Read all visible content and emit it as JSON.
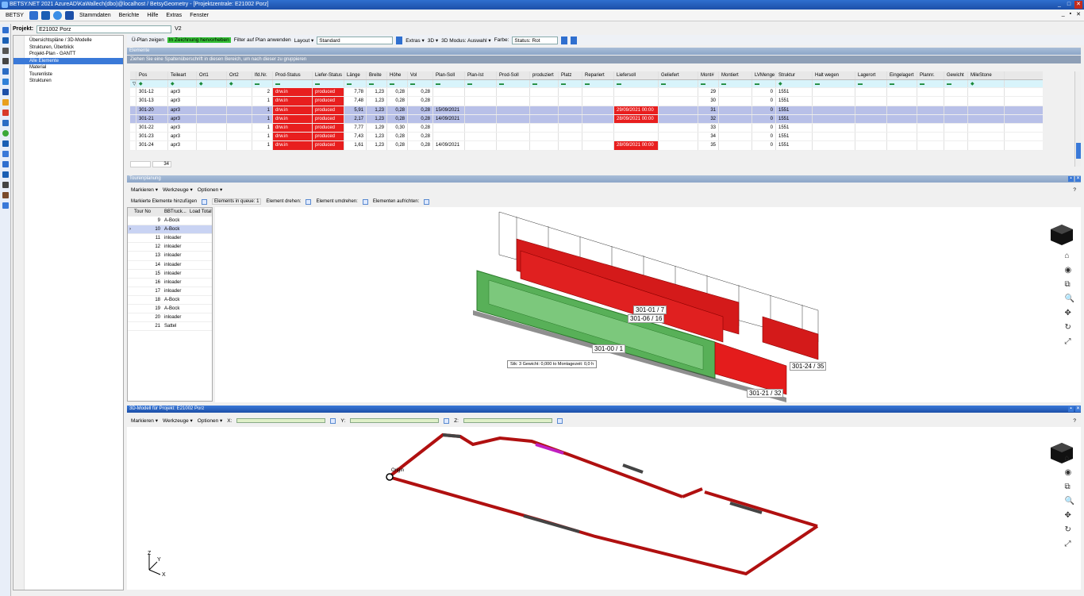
{
  "window": {
    "title": "BETSY.NET 2021  AzureAD\\KaWallech(dbo)@localhost / BetsyGeometry - [Projektzentrale: E21002 Porz]",
    "min": "_",
    "max": "□",
    "close": "✕"
  },
  "menu": {
    "app": "BETSY",
    "items": [
      "Stammdaten",
      "Berichte",
      "Hilfe",
      "Extras",
      "Fenster"
    ],
    "mdi": [
      "_",
      "▪",
      "✕"
    ]
  },
  "project": {
    "label": "Projekt:",
    "value": "E21002 Porz",
    "version": "V2"
  },
  "nav": {
    "items": [
      "Übersichtspläne / 3D-Modelle",
      "Strukturen, Überblick",
      "Projekt-Plan - GANTT",
      "Alle Elemente",
      "Material",
      "Tourenliste",
      "Strukturen"
    ],
    "selected": 3
  },
  "toolbar": {
    "plan_show": "Ü-Plan zeigen",
    "highlight": "In Zeichnung hervorheben",
    "filter": "Filter auf Plan anwenden",
    "layout": "Layout ▾",
    "layout_value": "Standard",
    "extras": "Extras ▾",
    "threeD": "3D ▾",
    "mode": "3D Modus: Auswahl ▾",
    "color_label": "Farbe:",
    "color_value": "Status: Rot"
  },
  "elements": {
    "header": "Elemente",
    "group_hint": "Ziehen Sie eine Spaltenüberschrift in diesen Bereich, um nach dieser zu gruppieren",
    "columns": [
      "Pos",
      "Teileart",
      "Ort1",
      "Ort2",
      "lfd.Nr.",
      "Prod-Status",
      "Liefer-Status",
      "Länge",
      "Breite",
      "Höhe",
      "Vol",
      "Plan-Soll",
      "Plan-Ist",
      "Prod-Soll",
      "produziert",
      "Platz",
      "Repariert",
      "Liefersoll",
      "Geliefert",
      "Mont#",
      "Montiert",
      "LVMenge",
      "Struktur",
      "Halt wegen",
      "Lagerort",
      "Eingelagert",
      "Plannr.",
      "Gewicht",
      "MileStone"
    ],
    "rows": [
      {
        "pos": "301-12",
        "teil": "apr3",
        "nr": "2",
        "prod": "drw.in",
        "lief": "produced",
        "l": "7,78",
        "b": "1,23",
        "h": "0,28",
        "plan": "",
        "liefer": "",
        "mont": "29",
        "lv": "0",
        "str": "1551",
        "sel": false
      },
      {
        "pos": "301-13",
        "teil": "apr3",
        "nr": "1",
        "prod": "drw.in",
        "lief": "produced",
        "l": "7,48",
        "b": "1,23",
        "h": "0,28",
        "plan": "",
        "liefer": "",
        "mont": "30",
        "lv": "0",
        "str": "1551",
        "sel": false
      },
      {
        "pos": "301-20",
        "teil": "apr3",
        "nr": "1",
        "prod": "drw.in",
        "lief": "produced",
        "l": "5,91",
        "b": "1,23",
        "h": "0,28",
        "plan": "15/09/2021",
        "liefer": "29/09/2021 00:00",
        "mont": "31",
        "lv": "0",
        "str": "1551",
        "sel": true
      },
      {
        "pos": "301-21",
        "teil": "apr3",
        "nr": "1",
        "prod": "drw.in",
        "lief": "produced",
        "l": "2,17",
        "b": "1,23",
        "h": "0,28",
        "plan": "14/09/2021",
        "liefer": "28/09/2021 00:00",
        "mont": "32",
        "lv": "0",
        "str": "1551",
        "sel": true
      },
      {
        "pos": "301-22",
        "teil": "apr3",
        "nr": "1",
        "prod": "drw.in",
        "lief": "produced",
        "l": "7,77",
        "b": "1,29",
        "h": "0,30",
        "plan": "",
        "liefer": "",
        "mont": "33",
        "lv": "0",
        "str": "1551",
        "sel": false
      },
      {
        "pos": "301-23",
        "teil": "apr3",
        "nr": "1",
        "prod": "drw.in",
        "lief": "produced",
        "l": "7,43",
        "b": "1,23",
        "h": "0,28",
        "plan": "",
        "liefer": "",
        "mont": "34",
        "lv": "0",
        "str": "1551",
        "sel": false
      },
      {
        "pos": "301-24",
        "teil": "apr3",
        "nr": "1",
        "prod": "drw.in",
        "lief": "produced",
        "l": "1,61",
        "b": "1,23",
        "h": "0,28",
        "plan": "14/09/2021",
        "liefer": "28/09/2021 00:00",
        "mont": "35",
        "lv": "0",
        "str": "1551",
        "sel": false
      }
    ],
    "count": "34"
  },
  "tour": {
    "header": "Tourenplanung",
    "menu": [
      "Markieren ▾",
      "Werkzeuge ▾",
      "Optionen ▾"
    ],
    "help": "?",
    "opts": {
      "add": "Markierte Elemente hinzufügen",
      "queue": "Elements in queue: 1",
      "rotate": "Element drehen:",
      "flip": "Element umdrehen:",
      "upright": "Elementen aufrichten:"
    },
    "columns": [
      "Tour No",
      "BBTruck...",
      "Load Total"
    ],
    "rows": [
      [
        "9",
        "A-Bock"
      ],
      [
        "10",
        "A-Bock"
      ],
      [
        "11",
        "inloader"
      ],
      [
        "12",
        "inloader"
      ],
      [
        "13",
        "inloader"
      ],
      [
        "14",
        "inloader"
      ],
      [
        "15",
        "inloader"
      ],
      [
        "16",
        "inloader"
      ],
      [
        "17",
        "inloader"
      ],
      [
        "18",
        "A-Bock"
      ],
      [
        "19",
        "A-Bock"
      ],
      [
        "20",
        "inloader"
      ],
      [
        "21",
        "Sattel"
      ]
    ],
    "selected": 1,
    "labels": [
      "301-01 / 7",
      "301-06 / 16",
      "301-00 / 1",
      "301-24 / 35",
      "301-21 / 32"
    ],
    "tooltip": "Stk: 3    Gewicht: 0,000 to    Montagezeit: 0,0 h"
  },
  "model": {
    "header": "3D-Modell für Projekt: E21002 Porz",
    "menu": [
      "Markieren ▾",
      "Werkzeuge ▾",
      "Optionen ▾"
    ],
    "x": "X:",
    "y": "Y:",
    "z": "Z:",
    "origin": "Origin",
    "help": "?",
    "axes": {
      "z": "Z",
      "y": "Y",
      "x": "X"
    }
  },
  "nav3d": {
    "icons": [
      "home-icon",
      "camera-icon",
      "zoom-box-icon",
      "zoom-icon",
      "pan-icon",
      "rotate-icon",
      "fit-icon"
    ],
    "glyphs": [
      "⌂",
      "◉",
      "⧉",
      "🔍",
      "✥",
      "↻",
      "⤢"
    ]
  },
  "colors": {
    "red": "#e81e1e",
    "selected": "#b8c0e8",
    "accent": "#3a79d8",
    "green": "#36c236"
  }
}
